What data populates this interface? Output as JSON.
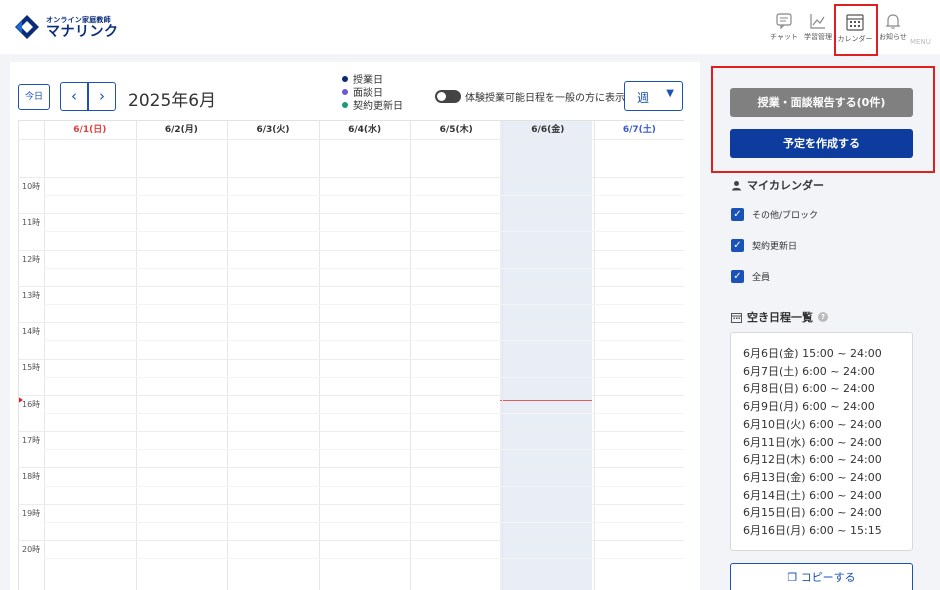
{
  "header": {
    "logo_sub": "オンライン家庭教師",
    "logo_main": "マナリンク",
    "nav": [
      {
        "label": "チャット",
        "icon": "chat-icon"
      },
      {
        "label": "学習管理",
        "icon": "chart-icon"
      },
      {
        "label": "カレンダー",
        "icon": "calendar-icon"
      },
      {
        "label": "お知らせ",
        "icon": "bell-icon"
      }
    ],
    "menu_label": "MENU"
  },
  "calendar": {
    "today_label": "今日",
    "prev_label": "‹",
    "next_label": "›",
    "title": "2025年6月",
    "legend": [
      {
        "label": "授業日",
        "color": "#0d2a6e"
      },
      {
        "label": "面談日",
        "color": "#6a5ad8"
      },
      {
        "label": "契約更新日",
        "color": "#1a9a7a"
      }
    ],
    "toggle_label": "体験授業可能日程を一般の方に表示",
    "view_value": "週",
    "days": [
      {
        "label": "6/1(日)",
        "color": "#e04040"
      },
      {
        "label": "6/2(月)",
        "color": "#333333"
      },
      {
        "label": "6/3(火)",
        "color": "#333333"
      },
      {
        "label": "6/4(水)",
        "color": "#333333"
      },
      {
        "label": "6/5(木)",
        "color": "#333333"
      },
      {
        "label": "6/6(金)",
        "color": "#333333"
      },
      {
        "label": "6/7(土)",
        "color": "#3a5ad8"
      }
    ],
    "hours": [
      "10時",
      "11時",
      "12時",
      "13時",
      "14時",
      "15時",
      "16時",
      "17時",
      "18時",
      "19時",
      "20時"
    ]
  },
  "side": {
    "report_button": "授業・面談報告する(0件)",
    "create_button": "予定を作成する",
    "my_calendar_title": "マイカレンダー",
    "checks": [
      "その他/ブロック",
      "契約更新日",
      "全員"
    ],
    "slots_title": "空き日程一覧",
    "help_label": "?",
    "slots": [
      "6月6日(金) 15:00 ~ 24:00",
      "6月7日(土) 6:00 ~ 24:00",
      "6月8日(日) 6:00 ~ 24:00",
      "6月9日(月) 6:00 ~ 24:00",
      "6月10日(火) 6:00 ~ 24:00",
      "6月11日(水) 6:00 ~ 24:00",
      "6月12日(木) 6:00 ~ 24:00",
      "6月13日(金) 6:00 ~ 24:00",
      "6月14日(土) 6:00 ~ 24:00",
      "6月15日(日) 6:00 ~ 24:00",
      "6月16日(月) 6:00 ~ 15:15"
    ],
    "copy_button": "コピーする"
  },
  "colors": {
    "accent": "#1a52b8",
    "primary_button": "#0d3c9e",
    "disabled_button": "#808080",
    "highlight": "#e02020"
  }
}
